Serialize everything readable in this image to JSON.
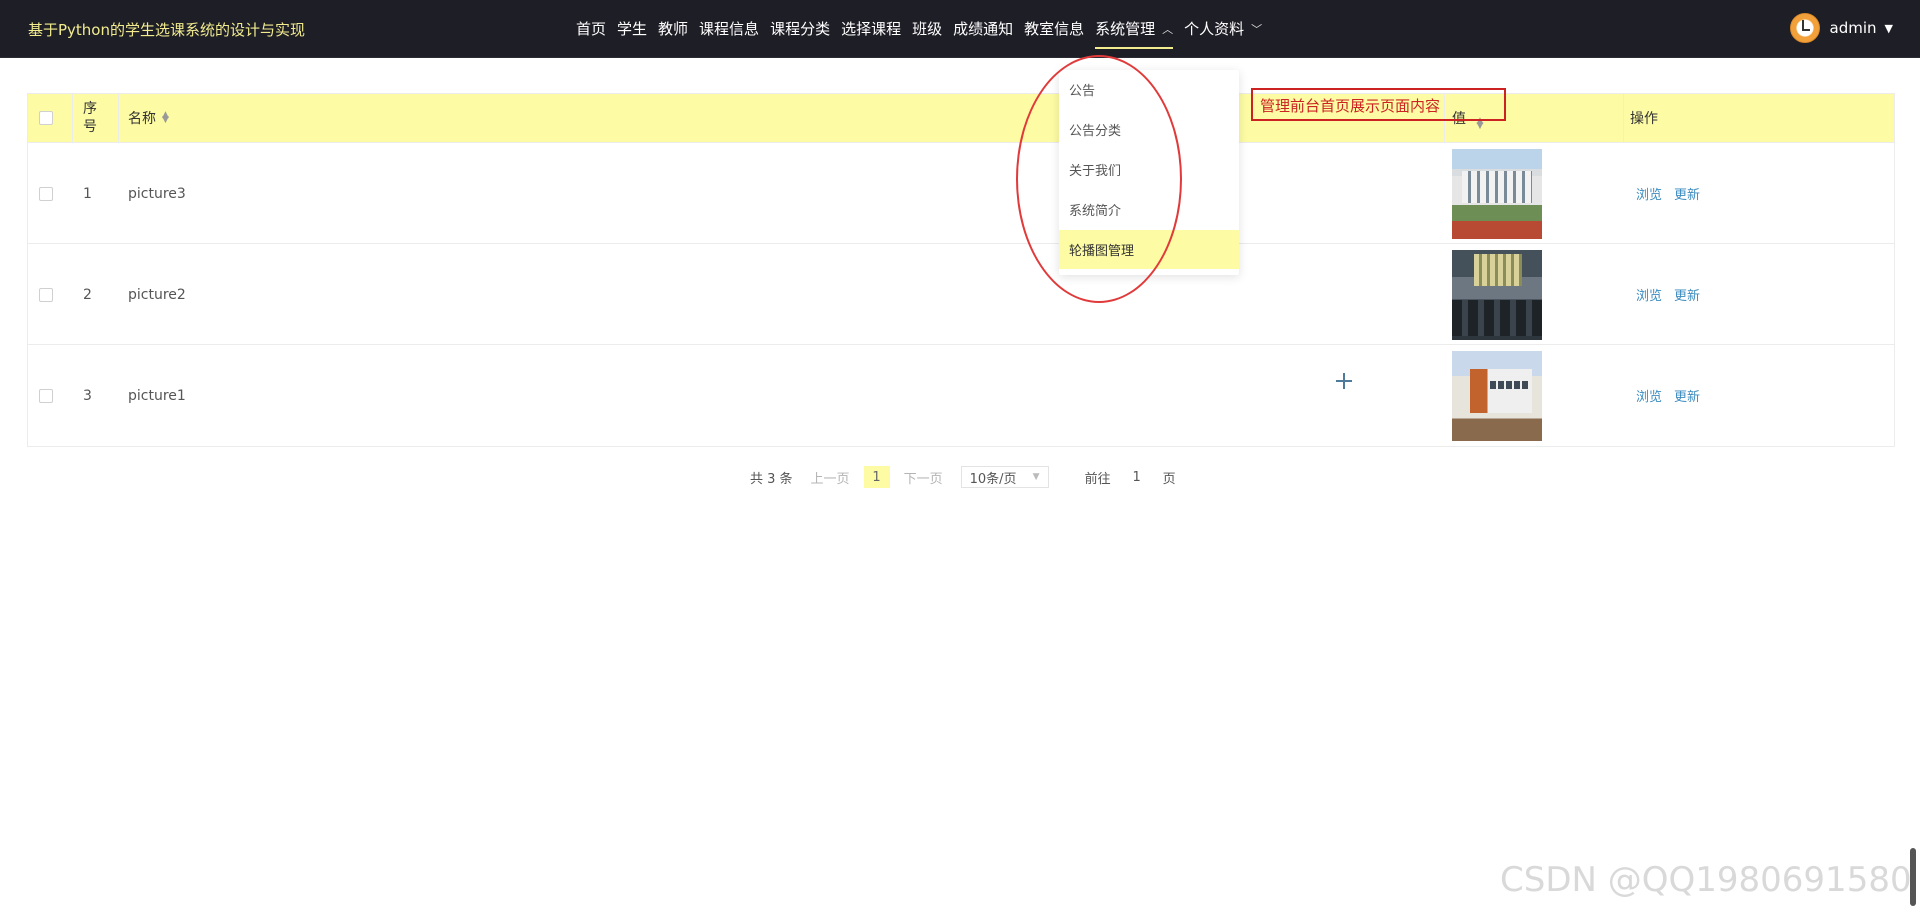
{
  "app": {
    "title": "基于Python的学生选课系统的设计与实现"
  },
  "nav": {
    "items": [
      {
        "label": "首页"
      },
      {
        "label": "学生"
      },
      {
        "label": "教师"
      },
      {
        "label": "课程信息"
      },
      {
        "label": "课程分类"
      },
      {
        "label": "选择课程"
      },
      {
        "label": "班级"
      },
      {
        "label": "成绩通知"
      },
      {
        "label": "教室信息"
      },
      {
        "label": "系统管理"
      },
      {
        "label": "个人资料"
      }
    ]
  },
  "user": {
    "name": "admin"
  },
  "dropdown": {
    "items": [
      {
        "label": "公告"
      },
      {
        "label": "公告分类"
      },
      {
        "label": "关于我们"
      },
      {
        "label": "系统简介"
      },
      {
        "label": "轮播图管理"
      }
    ],
    "active_index": 4
  },
  "annotation": {
    "note": "管理前台首页展示页面内容"
  },
  "table": {
    "headers": {
      "seq": "序号",
      "name": "名称",
      "value": "值",
      "actions": "操作"
    },
    "rows": [
      {
        "seq": "1",
        "name": "picture3"
      },
      {
        "seq": "2",
        "name": "picture2"
      },
      {
        "seq": "3",
        "name": "picture1"
      }
    ],
    "action_labels": {
      "view": "浏览",
      "update": "更新"
    }
  },
  "pagination": {
    "total_text": "共 3 条",
    "prev": "上一页",
    "current_page": "1",
    "next": "下一页",
    "page_size": "10条/页",
    "goto_prefix": "前往",
    "goto_value": "1",
    "goto_suffix": "页"
  },
  "watermark": "CSDN @QQ1980691580"
}
